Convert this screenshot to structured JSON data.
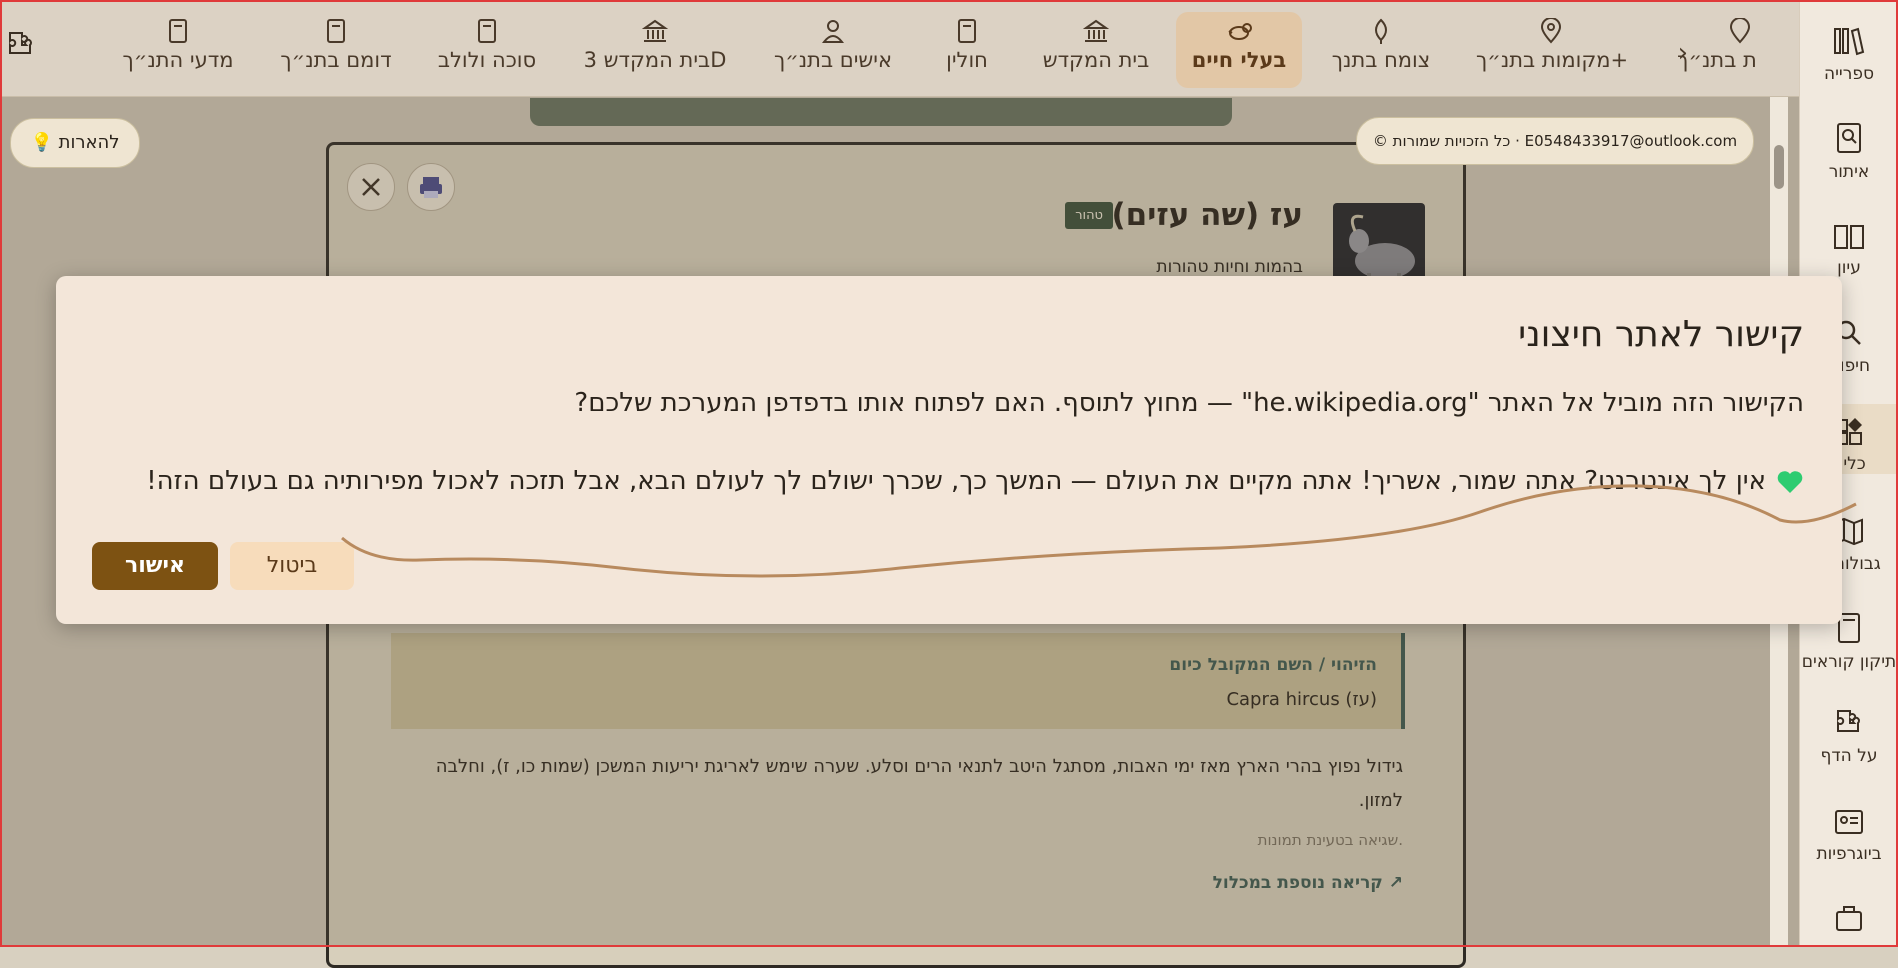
{
  "nav": {
    "tabs": [
      {
        "label": "מדעי התנ״ך",
        "icon": "book-icon"
      },
      {
        "label": "דומם בתנ״ך",
        "icon": "book-icon"
      },
      {
        "label": "סוכה ולולב",
        "icon": "book-icon"
      },
      {
        "label": "בית המקדש 3D",
        "icon": "temple-icon"
      },
      {
        "label": "אישים בתנ״ך",
        "icon": "person-icon"
      },
      {
        "label": "חולין",
        "icon": "book-icon"
      },
      {
        "label": "בית המקדש",
        "icon": "temple-icon"
      },
      {
        "label": "בעלי חיים",
        "icon": "animal-icon",
        "active": true
      },
      {
        "label": "צומח בתנך",
        "icon": "leaf-icon"
      },
      {
        "label": "מקומות בתנ״ך+",
        "icon": "map-pin-icon"
      },
      {
        "label": "ת בתנ״ך",
        "icon": "map-pin-icon"
      }
    ]
  },
  "sidebar": {
    "items": [
      {
        "label": "ספרייה",
        "icon": "library-icon"
      },
      {
        "label": "איתור",
        "icon": "search-book-icon"
      },
      {
        "label": "עיון",
        "icon": "open-book-icon"
      },
      {
        "label": "חיפוש",
        "icon": "search-icon"
      },
      {
        "label": "כליה",
        "icon": "tools-icon",
        "active": true
      },
      {
        "label": "גבולות ה",
        "icon": "map-icon"
      },
      {
        "label": "תיקון קוראים",
        "icon": "book-icon"
      },
      {
        "label": "על הדף",
        "icon": "puzzle-icon"
      },
      {
        "label": "ביוגרפיות",
        "icon": "id-card-icon"
      },
      {
        "label": "",
        "icon": "briefcase-icon"
      }
    ]
  },
  "hints_button": "💡 להארות",
  "copyright": "© כל הזכויות שמורות · E0548433917@outlook.com",
  "entry": {
    "title": "עז (שה עזים)",
    "badge": "טהור",
    "subtitle": "בהמות וחיות טהורות",
    "id_heading": "הזיהוי / השם המקובל כיום",
    "id_value": "Capra hircus (עז)",
    "description": "גידול נפוץ בהרי הארץ מאז ימי האבות, מסתגל היטב לתנאי הרים וסלע. שערה שימש לאריגת יריעות המשכן (שמות כו, ז), וחלבה למזון.",
    "image_error": "שגיאה בטעינת תמונות.",
    "read_more": "קריאה נוספת במכלול ↗"
  },
  "dialog": {
    "title": "קישור לאתר חיצוני",
    "text": "הקישור הזה מוביל אל האתר \"he.wikipedia.org\" — מחוץ לתוסף. האם לפתוח אותו בדפדפן המערכת שלכם?",
    "note": "אין לך אינטרנט? אתה שמור, אשריך! אתה מקיים את העולם — המשך כך, שכרך ישולם לך לעולם הבא, אבל תזכה לאכול מפירותיה גם בעולם הזה!",
    "confirm": "אישור",
    "cancel": "ביטול"
  },
  "colors": {
    "accent": "#7d5212",
    "active_tab": "#e2c7a6",
    "heart": "#2ecc71",
    "scribble": "#b88a5e"
  }
}
